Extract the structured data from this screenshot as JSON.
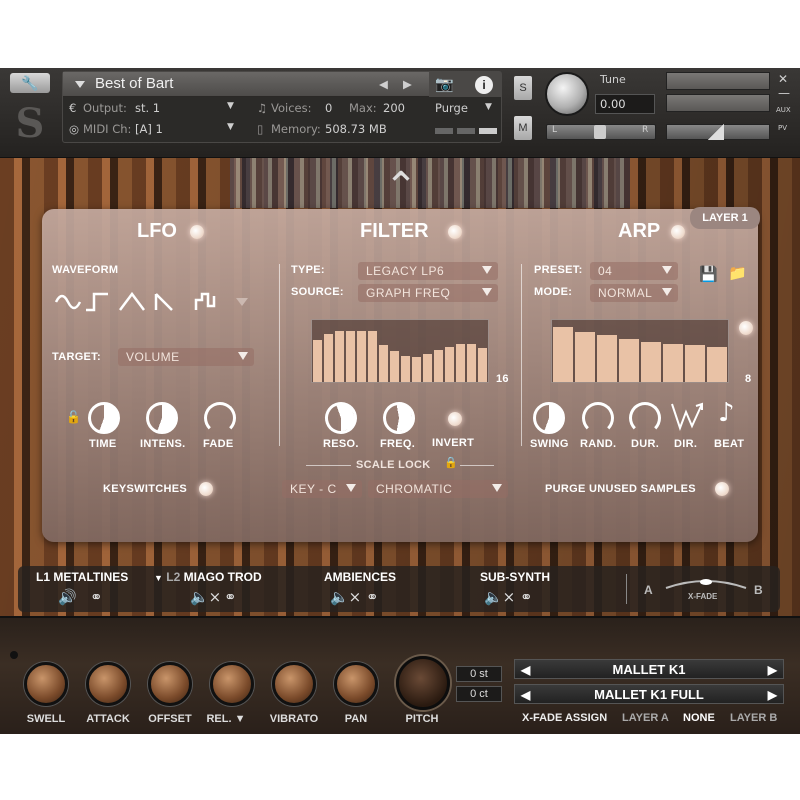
{
  "header": {
    "instrument_name": "Best of Bart",
    "output_label": "Output:",
    "output_value": "st. 1",
    "voices_label": "Voices:",
    "voices_value": "0",
    "max_label": "Max:",
    "max_value": "200",
    "purge_label": "Purge",
    "midi_label": "MIDI Ch:",
    "midi_value": "[A] 1",
    "memory_label": "Memory:",
    "memory_value": "508.73 MB",
    "solo": "S",
    "mute": "M",
    "tune_label": "Tune",
    "tune_value": "0.00",
    "pan_l": "L",
    "pan_r": "R",
    "aux": "AUX",
    "pv": "PV"
  },
  "panel": {
    "layer_badge": "LAYER 1",
    "lfo": {
      "title": "LFO",
      "waveform_label": "WAVEFORM",
      "target_label": "TARGET:",
      "target_value": "VOLUME",
      "knobs": [
        "TIME",
        "INTENS.",
        "FADE"
      ],
      "keyswitches": "KEYSWITCHES"
    },
    "filter": {
      "title": "FILTER",
      "type_label": "TYPE:",
      "type_value": "LEGACY LP6",
      "source_label": "SOURCE:",
      "source_value": "GRAPH FREQ",
      "steps": "16",
      "knobs": [
        "RESO.",
        "FREQ.",
        "INVERT"
      ],
      "scale_lock": "SCALE LOCK",
      "key_value": "KEY - C",
      "scale_value": "CHROMATIC"
    },
    "arp": {
      "title": "ARP",
      "preset_label": "PRESET:",
      "preset_value": "04",
      "mode_label": "MODE:",
      "mode_value": "NORMAL",
      "steps": "8",
      "knobs": [
        "SWING",
        "RAND.",
        "DUR.",
        "DIR.",
        "BEAT"
      ],
      "purge": "PURGE UNUSED SAMPLES"
    }
  },
  "filter_steps": [
    0.68,
    0.78,
    0.82,
    0.83,
    0.83,
    0.82,
    0.6,
    0.5,
    0.42,
    0.4,
    0.45,
    0.52,
    0.57,
    0.62,
    0.62,
    0.55
  ],
  "arp_steps": [
    0.88,
    0.8,
    0.76,
    0.7,
    0.64,
    0.62,
    0.6,
    0.57
  ],
  "layers": [
    {
      "prefix": "L1",
      "name": "METALTINES"
    },
    {
      "prefix": "L2",
      "name": "MIAGO TROD"
    },
    {
      "prefix": "",
      "name": "AMBIENCES"
    },
    {
      "prefix": "",
      "name": "SUB-SYNTH"
    }
  ],
  "xfade": {
    "a": "A",
    "b": "B",
    "label": "X-FADE"
  },
  "bottom": {
    "knobs": [
      "SWELL",
      "ATTACK",
      "OFFSET",
      "REL.",
      "VIBRATO",
      "PAN",
      "PITCH"
    ],
    "st_value": "0 st",
    "ct_value": "0 ct",
    "preset1": "MALLET K1",
    "preset2": "MALLET K1 FULL",
    "xfade_assign": "X-FADE ASSIGN",
    "opt_a": "LAYER A",
    "opt_none": "NONE",
    "opt_b": "LAYER B"
  }
}
